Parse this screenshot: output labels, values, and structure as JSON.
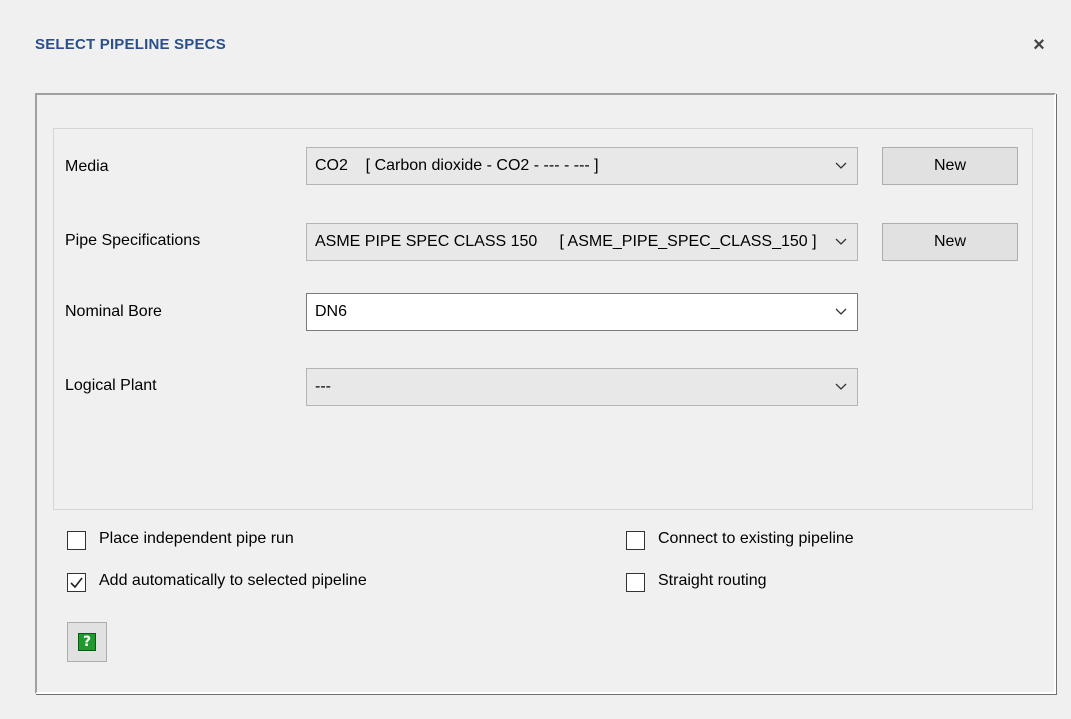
{
  "dialog": {
    "title": "SELECT PIPELINE SPECS",
    "close_glyph": "×"
  },
  "form": {
    "media": {
      "label": "Media",
      "value": "CO2    [ Carbon dioxide - CO2 - --- - --- ]",
      "button": "New"
    },
    "pipe_spec": {
      "label": "Pipe Specifications",
      "value": "ASME PIPE SPEC CLASS 150     [ ASME_PIPE_SPEC_CLASS_150 ]",
      "button": "New"
    },
    "nominal_bore": {
      "label": "Nominal Bore",
      "value": "DN6"
    },
    "logical_plant": {
      "label": "Logical Plant",
      "value": "---"
    }
  },
  "options": {
    "place_independent": {
      "label": "Place independent pipe run",
      "checked": false
    },
    "add_automatically": {
      "label": "Add automatically to selected pipeline",
      "checked": true
    },
    "connect_existing": {
      "label": "Connect to existing pipeline",
      "checked": false
    },
    "straight_routing": {
      "label": "Straight routing",
      "checked": false
    }
  },
  "help": {
    "glyph": "?",
    "icon": "help-icon",
    "color": "#1e9a2e"
  },
  "colors": {
    "title": "#2b4f8c",
    "background": "#f0f0f0"
  }
}
